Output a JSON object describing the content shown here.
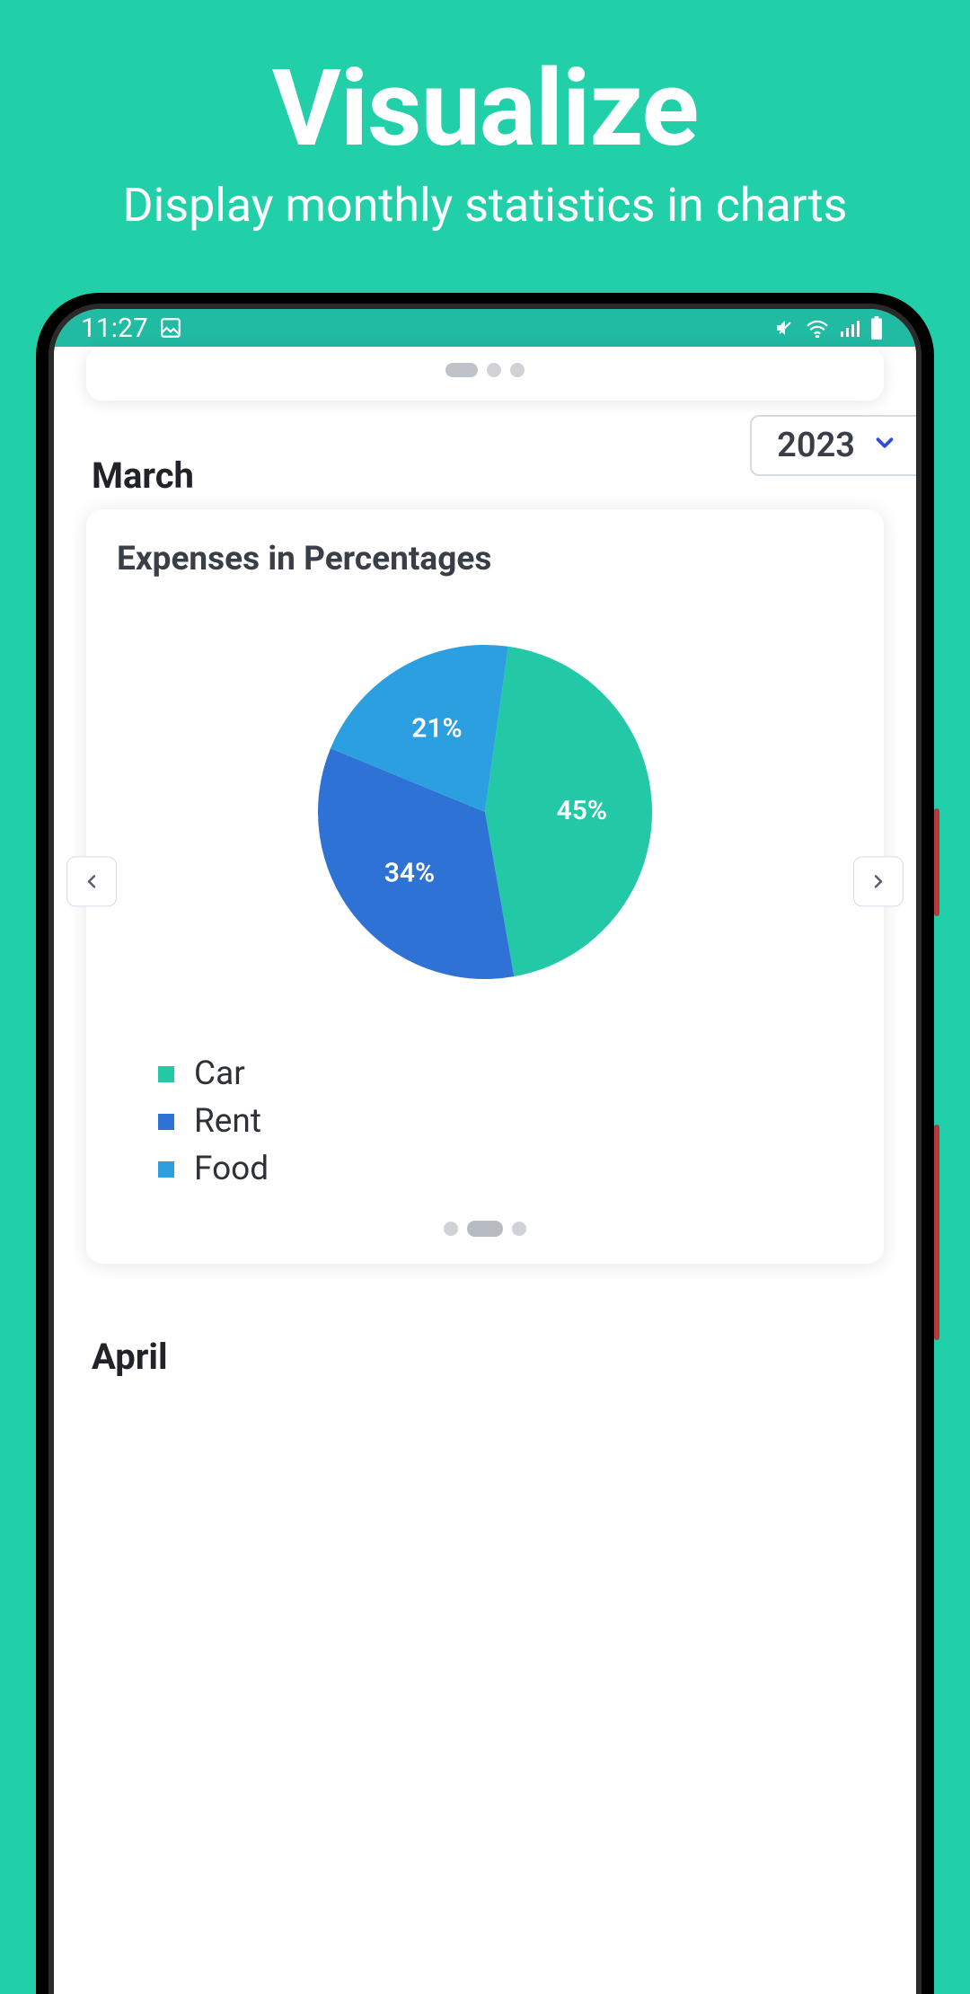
{
  "hero": {
    "title": "Visualize",
    "subtitle": "Display monthly statistics in charts"
  },
  "status": {
    "time": "11:27",
    "battery_full": true
  },
  "year_selector": {
    "value": "2023"
  },
  "current_month": "March",
  "next_month": "April",
  "colors": {
    "accent": "#21d0a9",
    "status_bg": "#21baa2",
    "slice_car": "#23c9a6",
    "slice_rent": "#2e72d6",
    "slice_food": "#2b9fe0",
    "chevron": "#2f4fd8"
  },
  "card": {
    "title": "Expenses in Percentages"
  },
  "chart_data": {
    "type": "pie",
    "title": "Expenses in Percentages",
    "series": [
      {
        "name": "Car",
        "value": 45,
        "label": "45%",
        "color": "#23c9a6"
      },
      {
        "name": "Rent",
        "value": 34,
        "label": "34%",
        "color": "#2e72d6"
      },
      {
        "name": "Food",
        "value": 21,
        "label": "21%",
        "color": "#2b9fe0"
      }
    ],
    "ylim": [
      0,
      100
    ]
  }
}
